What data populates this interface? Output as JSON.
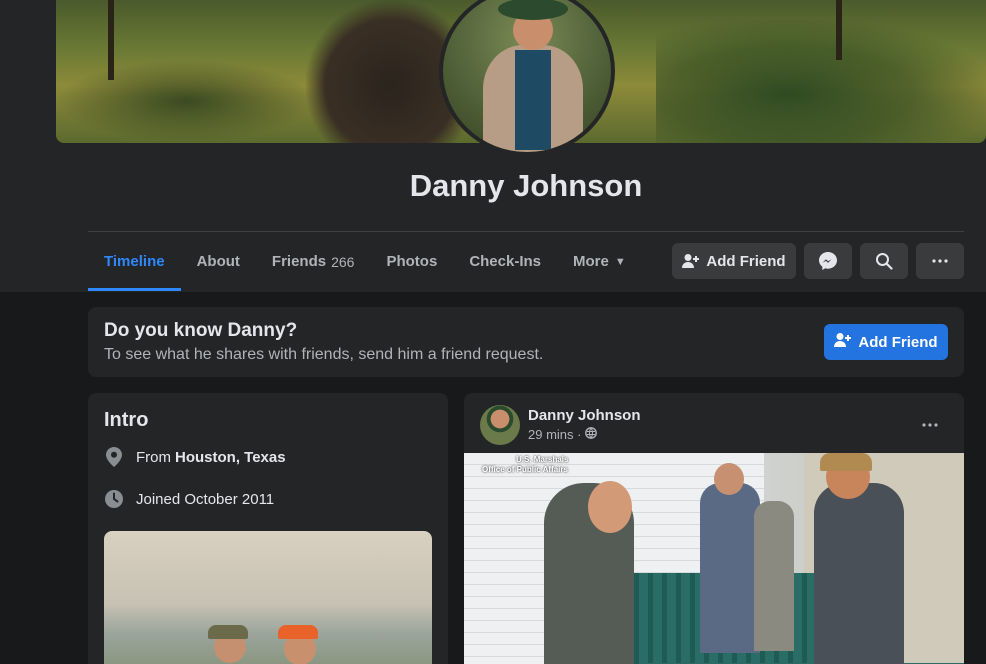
{
  "profile": {
    "name": "Danny Johnson"
  },
  "tabs": [
    {
      "label": "Timeline"
    },
    {
      "label": "About"
    },
    {
      "label": "Friends",
      "count": "266"
    },
    {
      "label": "Photos"
    },
    {
      "label": "Check-Ins"
    },
    {
      "label": "More"
    }
  ],
  "actions": {
    "add_friend_label": "Add Friend",
    "messenger_icon": "messenger-icon",
    "search_icon": "search-icon",
    "more_icon": "more-icon"
  },
  "know_card": {
    "title": "Do you know Danny?",
    "subtitle": "To see what he shares with friends, send him a friend request.",
    "button_label": "Add Friend"
  },
  "intro": {
    "title": "Intro",
    "from_prefix": "From",
    "from_place": "Houston, Texas",
    "joined": "Joined October 2011"
  },
  "post": {
    "author": "Danny Johnson",
    "time": "29 mins ·",
    "image_watermark_line1": "U.S. Marshals",
    "image_watermark_line2": "Office of Public Affairs"
  },
  "colors": {
    "accent": "#2d88ff",
    "button_primary": "#2374e1",
    "surface": "#242526",
    "background": "#18191a"
  }
}
